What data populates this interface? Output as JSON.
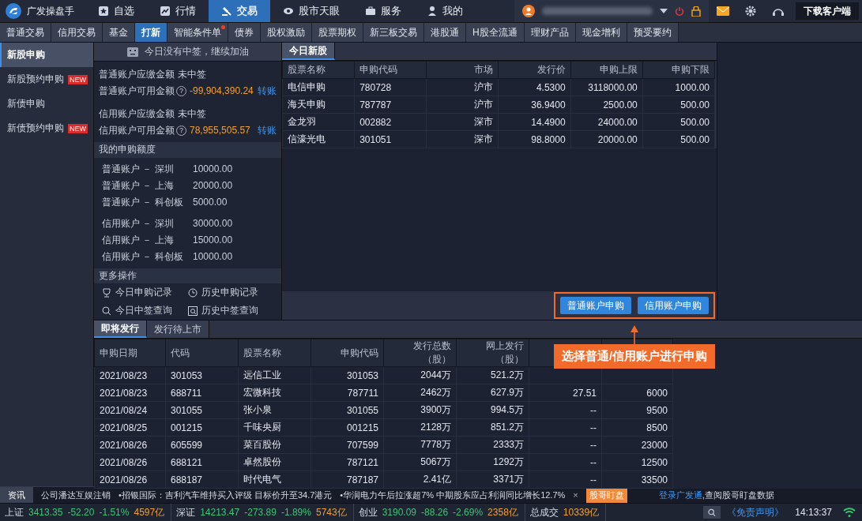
{
  "top_nav": {
    "app_name": "广发操盘手",
    "items": [
      {
        "label": "自选",
        "selected": false
      },
      {
        "label": "行情",
        "selected": false
      },
      {
        "label": "交易",
        "selected": true
      },
      {
        "label": "股市天眼",
        "selected": false
      },
      {
        "label": "服务",
        "selected": false
      },
      {
        "label": "我的",
        "selected": false
      }
    ],
    "download_button": "下载客户端"
  },
  "sub_tabs": [
    {
      "label": "普通交易",
      "selected": false,
      "dot": false
    },
    {
      "label": "信用交易",
      "selected": false,
      "dot": false
    },
    {
      "label": "基金",
      "selected": false,
      "dot": false
    },
    {
      "label": "打新",
      "selected": true,
      "dot": false
    },
    {
      "label": "智能条件单",
      "selected": false,
      "dot": true
    },
    {
      "label": "债券",
      "selected": false,
      "dot": false
    },
    {
      "label": "股权激励",
      "selected": false,
      "dot": false
    },
    {
      "label": "股票期权",
      "selected": false,
      "dot": false
    },
    {
      "label": "新三板交易",
      "selected": false,
      "dot": false
    },
    {
      "label": "港股通",
      "selected": false,
      "dot": false
    },
    {
      "label": "H股全流通",
      "selected": false,
      "dot": false
    },
    {
      "label": "理财产品",
      "selected": false,
      "dot": false
    },
    {
      "label": "现金增利",
      "selected": false,
      "dot": false
    },
    {
      "label": "预受要约",
      "selected": false,
      "dot": false
    }
  ],
  "sidebar": {
    "items": [
      {
        "label": "新股申购",
        "selected": true
      },
      {
        "label": "新股预约申购",
        "selected": false,
        "badge": "NEW"
      },
      {
        "label": "新债申购",
        "selected": false
      },
      {
        "label": "新债预约申购",
        "selected": false,
        "badge": "NEW"
      }
    ]
  },
  "summary": {
    "notice": "今日没有中签，继续加油",
    "fund_groups": [
      [
        {
          "label": "普通账户应缴金额",
          "value": "未中签",
          "kind": "status"
        },
        {
          "label": "普通账户可用金额",
          "help": "?",
          "value": "-99,904,390.24",
          "kind": "amount",
          "link": "转账"
        }
      ],
      [
        {
          "label": "信用账户应缴金额",
          "value": "未中签",
          "kind": "status"
        },
        {
          "label": "信用账户可用金额",
          "help": "?",
          "value": "78,955,505.57",
          "kind": "amount",
          "link": "转账"
        }
      ]
    ],
    "quota": {
      "title": "我的申购额度",
      "groups": [
        [
          {
            "label": "普通账户 － 深圳",
            "value": "10000.00"
          },
          {
            "label": "普通账户 － 上海",
            "value": "20000.00"
          },
          {
            "label": "普通账户 － 科创板",
            "value": "5000.00"
          }
        ],
        [
          {
            "label": "信用账户 － 深圳",
            "value": "30000.00"
          },
          {
            "label": "信用账户 － 上海",
            "value": "15000.00"
          },
          {
            "label": "信用账户 － 科创板",
            "value": "10000.00"
          }
        ]
      ]
    },
    "more": {
      "title": "更多操作",
      "items": [
        "今日申购记录",
        "历史申购记录",
        "今日中签查询",
        "历史中签查询"
      ]
    }
  },
  "today_ipos": {
    "tabs": [
      {
        "label": "今日新股",
        "selected": true
      }
    ],
    "columns": [
      "股票名称",
      "申购代码",
      "市场",
      "发行价",
      "申购上限",
      "申购下限"
    ],
    "rows": [
      [
        "电信申购",
        "780728",
        "沪市",
        "4.5300",
        "3118000.00",
        "1000.00"
      ],
      [
        "海天申购",
        "787787",
        "沪市",
        "36.9400",
        "2500.00",
        "500.00"
      ],
      [
        "金龙羽",
        "002882",
        "深市",
        "14.4900",
        "24000.00",
        "500.00"
      ],
      [
        "信濠光电",
        "301051",
        "深市",
        "98.8000",
        "20000.00",
        "500.00"
      ]
    ],
    "buttons": [
      "普通账户申购",
      "信用账户申购"
    ]
  },
  "callout": "选择普通/信用账户进行申购",
  "upcoming": {
    "tabs": [
      {
        "label": "即将发行",
        "selected": true
      },
      {
        "label": "发行待上市",
        "selected": false
      }
    ],
    "columns": [
      "申购日期",
      "代码",
      "股票名称",
      "申购代码",
      "发行总数（股）",
      "网上发行（股）"
    ],
    "rows": [
      [
        "2021/08/23",
        "301053",
        "远信工业",
        "301053",
        "2044万",
        "521.2万"
      ],
      [
        "2021/08/23",
        "688711",
        "宏微科技",
        "787711",
        "2462万",
        "627.9万",
        "27.51",
        "6000"
      ],
      [
        "2021/08/24",
        "301055",
        "张小泉",
        "301055",
        "3900万",
        "994.5万",
        "--",
        "9500"
      ],
      [
        "2021/08/25",
        "001215",
        "千味央厨",
        "001215",
        "2128万",
        "851.2万",
        "--",
        "8500"
      ],
      [
        "2021/08/26",
        "605599",
        "菜百股份",
        "707599",
        "7778万",
        "2333万",
        "--",
        "23000"
      ],
      [
        "2021/08/26",
        "688121",
        "卓然股份",
        "787121",
        "5067万",
        "1292万",
        "--",
        "12500"
      ],
      [
        "2021/08/26",
        "688187",
        "时代电气",
        "787187",
        "2.41亿",
        "3371万",
        "--",
        "33500"
      ]
    ]
  },
  "ticker": {
    "label": "资讯",
    "items": [
      "公司潘达互娱注销",
      "•招银国际：吉利汽车维持买入评级 目标价升至34.7港元",
      "•华润电力午后拉涨超7% 中期股东应占利润同比增长12.7%"
    ],
    "close": "×",
    "tag": "股哥盯盘",
    "link": "登录广发通",
    "text": ",查阅股哥盯盘数据"
  },
  "status_bar": {
    "indices": [
      {
        "name": "上证",
        "price": "3413.35",
        "change": "-52.20",
        "pct": "-1.51%",
        "amount": "4597亿"
      },
      {
        "name": "深证",
        "price": "14213.47",
        "change": "-273.89",
        "pct": "-1.89%",
        "amount": "5743亿"
      },
      {
        "name": "创业",
        "price": "3190.09",
        "change": "-88.26",
        "pct": "-2.69%",
        "amount": "2358亿"
      }
    ],
    "total_label": "总成交",
    "total_value": "10339亿",
    "disclaimer": "《免责声明》",
    "time": "14:13:37"
  }
}
